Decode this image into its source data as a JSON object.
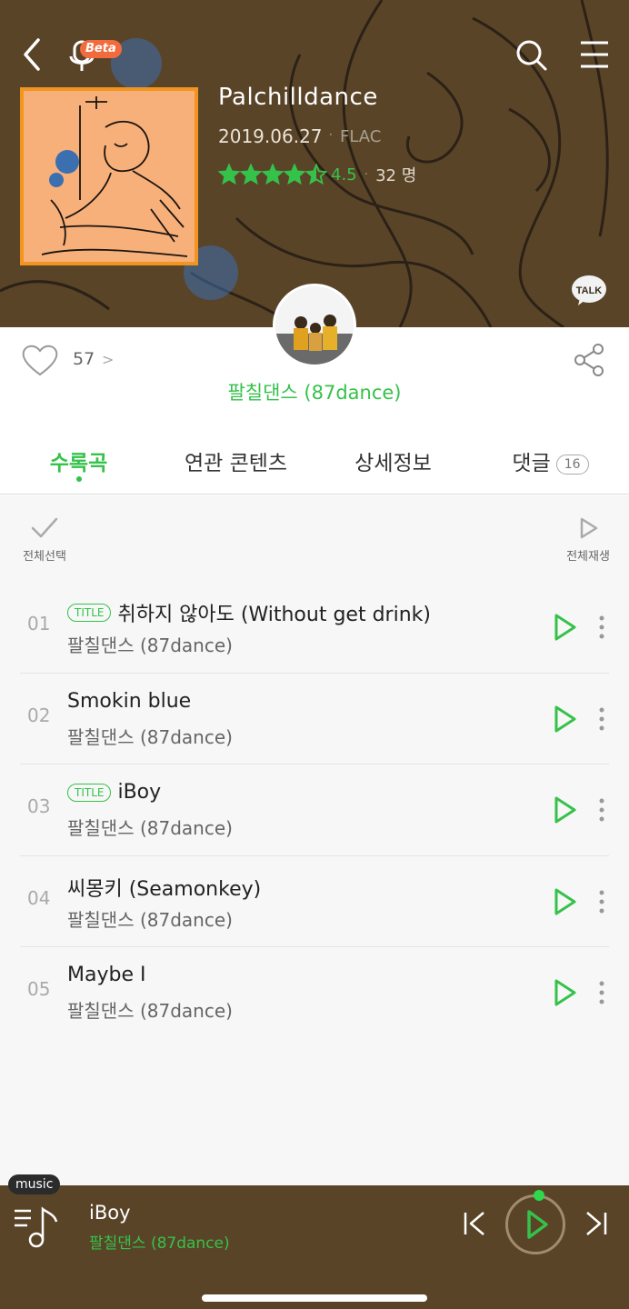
{
  "header": {
    "mic_badge": "Beta",
    "talk_label": "TALK",
    "icons": {
      "back": "back-chevron-icon",
      "mic": "microphone-icon",
      "search": "search-icon",
      "menu": "hamburger-menu-icon"
    }
  },
  "album": {
    "title": "Palchilldance",
    "date": "2019.06.27",
    "date_separator": "·",
    "format": "FLAC",
    "rating": 4.5,
    "rating_text": "4.5",
    "rating_separator": "·",
    "rating_count": "32 명"
  },
  "social": {
    "like_count": "57",
    "like_chevron": ">",
    "artist": "팔칠댄스 (87dance)"
  },
  "tabs": [
    {
      "label": "수록곡",
      "active": true
    },
    {
      "label": "연관 콘텐츠",
      "active": false
    },
    {
      "label": "상세정보",
      "active": false
    },
    {
      "label": "댓글",
      "active": false,
      "badge": "16"
    }
  ],
  "list_controls": {
    "select_all": "전체선택",
    "play_all": "전체재생"
  },
  "tracks": [
    {
      "num": "01",
      "badge": "TITLE",
      "title": "취하지 않아도 (Without get drink)",
      "artist": "팔칠댄스 (87dance)"
    },
    {
      "num": "02",
      "badge": "",
      "title": "Smokin blue",
      "artist": "팔칠댄스 (87dance)"
    },
    {
      "num": "03",
      "badge": "TITLE",
      "title": "iBoy",
      "artist": "팔칠댄스 (87dance)"
    },
    {
      "num": "04",
      "badge": "",
      "title": "씨몽키 (Seamonkey)",
      "artist": "팔칠댄스 (87dance)"
    },
    {
      "num": "05",
      "badge": "",
      "title": "Maybe I",
      "artist": "팔칠댄스 (87dance)"
    }
  ],
  "player": {
    "tag": "music",
    "title": "iBoy",
    "artist": "팔칠댄스 (87dance)"
  },
  "colors": {
    "accent": "#35c24a",
    "header_bg": "#5a4428",
    "cover_bg": "#f7b07a",
    "cover_border": "#f29520"
  }
}
